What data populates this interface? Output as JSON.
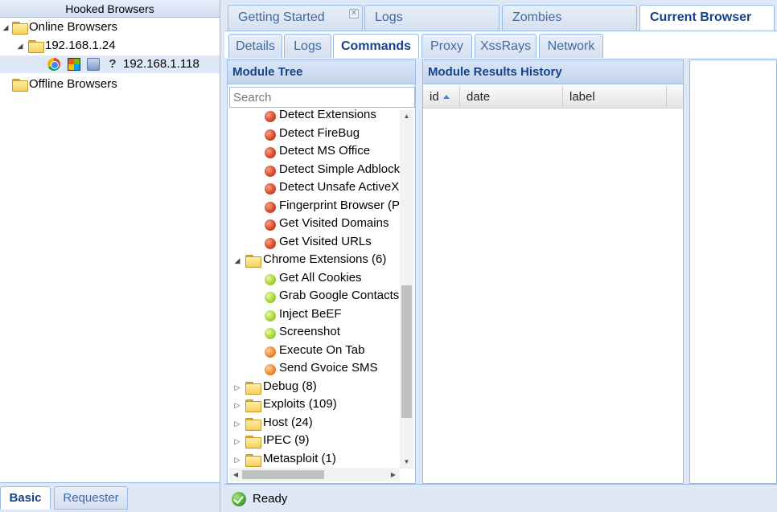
{
  "left_panel": {
    "title": "Hooked Browsers",
    "tree": {
      "online": "Online Browsers",
      "subnet": "192.168.1.24",
      "browser_ip": "192.168.1.118",
      "offline": "Offline Browsers"
    },
    "bottom_tabs": [
      "Basic",
      "Requester"
    ]
  },
  "main_tabs": [
    "Getting Started",
    "Logs",
    "Zombies",
    "Current Browser"
  ],
  "active_main_tab": "Current Browser",
  "sub_tabs": [
    "Details",
    "Logs",
    "Commands",
    "Proxy",
    "XssRays",
    "Network"
  ],
  "active_sub_tab": "Commands",
  "module_tree": {
    "title": "Module Tree",
    "search_placeholder": "Search",
    "items": [
      {
        "label": "Detect Extensions",
        "status": "red"
      },
      {
        "label": "Detect FireBug",
        "status": "red"
      },
      {
        "label": "Detect MS Office",
        "status": "red"
      },
      {
        "label": "Detect Simple Adblock",
        "status": "red"
      },
      {
        "label": "Detect Unsafe ActiveX",
        "status": "red"
      },
      {
        "label": "Fingerprint Browser (P",
        "status": "red"
      },
      {
        "label": "Get Visited Domains",
        "status": "red"
      },
      {
        "label": "Get Visited URLs",
        "status": "red"
      }
    ],
    "chrome_folder": "Chrome Extensions (6)",
    "chrome_items": [
      {
        "label": "Get All Cookies",
        "status": "green"
      },
      {
        "label": "Grab Google Contacts",
        "status": "green"
      },
      {
        "label": "Inject BeEF",
        "status": "green"
      },
      {
        "label": "Screenshot",
        "status": "green"
      },
      {
        "label": "Execute On Tab",
        "status": "orange"
      },
      {
        "label": "Send Gvoice SMS",
        "status": "orange"
      }
    ],
    "folders": [
      "Debug (8)",
      "Exploits (109)",
      "Host (24)",
      "IPEC (9)",
      "Metasploit (1)"
    ]
  },
  "results": {
    "title": "Module Results History",
    "columns": [
      "id",
      "date",
      "label"
    ]
  },
  "status": {
    "text": "Ready"
  }
}
